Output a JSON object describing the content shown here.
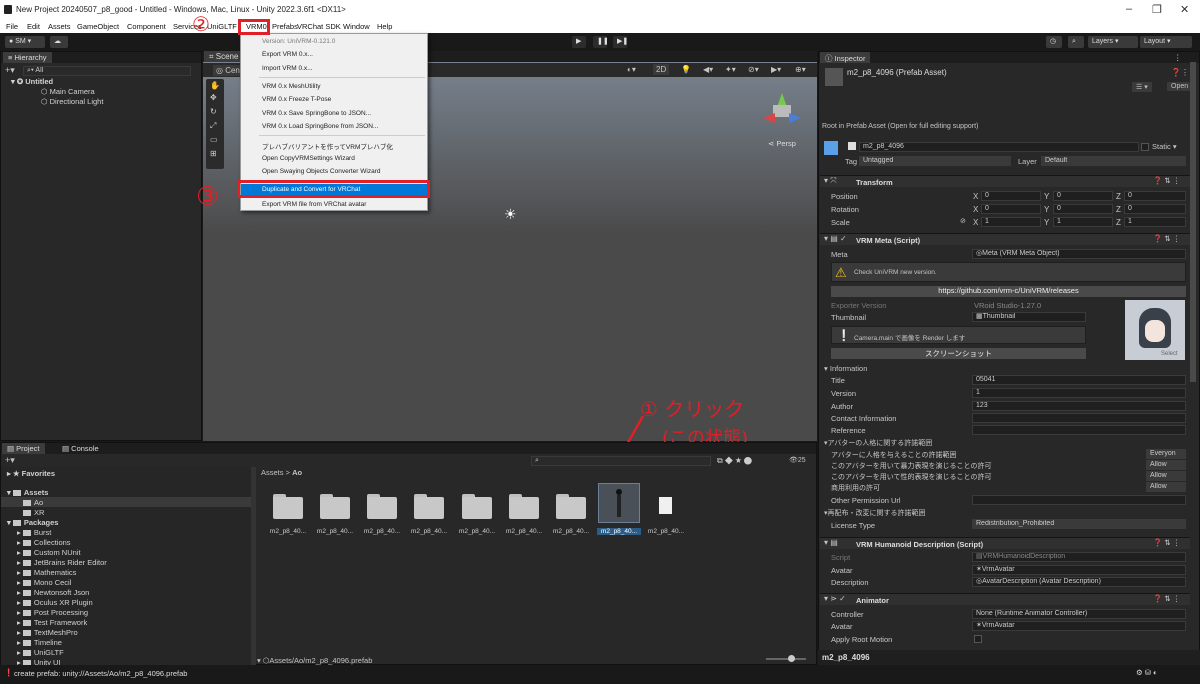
{
  "window": {
    "title": "New Project 20240507_p8_good - Untitled - Windows, Mac, Linux - Unity 2022.3.6f1 <DX11>"
  },
  "menubar": [
    "File",
    "Edit",
    "Assets",
    "GameObject",
    "Component",
    "Services",
    "UniGLTF",
    "VRM0",
    "Prefabs",
    "VRChat SDK",
    "Window",
    "Help"
  ],
  "toolbar": {
    "account": "SM",
    "layers": "Layers",
    "layout": "Layout"
  },
  "hierarchy": {
    "tab": "Hierarchy",
    "search": "All",
    "scene": "Untitled",
    "items": [
      "Main Camera",
      "Directional Light"
    ]
  },
  "scene_view": {
    "tab": "Scene",
    "persp": "Persp",
    "mode_2d": "2D",
    "camera_label": "Cen"
  },
  "vrm_menu": {
    "items": [
      "Version: UniVRM-0.121.0",
      "Export VRM 0.x...",
      "Import VRM 0.x...",
      "VRM 0.x MeshUtility",
      "VRM 0.x Freeze T-Pose",
      "VRM 0.x Save SpringBone to JSON...",
      "VRM 0.x Load SpringBone from JSON...",
      "プレハブバリアントを作ってVRMプレハブ化",
      "Open CopyVRMSettings Wizard",
      "Open Swaying Objects Converter Wizard",
      "Duplicate and Convert for VRChat",
      "Export VRM file from VRChat avatar"
    ]
  },
  "annotations": {
    "step1": "① クリック",
    "step1b": "(この状態)",
    "step2": "②",
    "step3": "③"
  },
  "project": {
    "tabs": [
      "Project",
      "Console"
    ],
    "favorites": "Favorites",
    "assets": "Assets",
    "asset_children": [
      "Ao",
      "XR"
    ],
    "packages": "Packages",
    "package_children": [
      "Burst",
      "Collections",
      "Custom NUnit",
      "JetBrains Rider Editor",
      "Mathematics",
      "Mono Cecil",
      "Newtonsoft Json",
      "Oculus XR Plugin",
      "Post Processing",
      "Test Framework",
      "TextMeshPro",
      "Timeline",
      "UniGLTF",
      "Unity UI"
    ],
    "breadcrumb": [
      "Assets",
      "Ao"
    ],
    "files": [
      "m2_p8_40...",
      "m2_p8_40...",
      "m2_p8_40...",
      "m2_p8_40...",
      "m2_p8_40...",
      "m2_p8_40...",
      "m2_p8_40...",
      "m2_p8_40...",
      "m2_p8_40..."
    ],
    "path": "Assets/Ao/m2_p8_4096.prefab",
    "count": "25"
  },
  "inspector": {
    "tab": "Inspector",
    "name": "m2_p8_4096 (Prefab Asset)",
    "open": "Open",
    "root_note": "Root in Prefab Asset (Open for full editing support)",
    "obj_name": "m2_p8_4096",
    "static": "Static",
    "tag_label": "Tag",
    "tag": "Untagged",
    "layer_label": "Layer",
    "layer": "Default",
    "transform": {
      "title": "Transform",
      "rows": [
        {
          "label": "Position",
          "x": "0",
          "y": "0",
          "z": "0"
        },
        {
          "label": "Rotation",
          "x": "0",
          "y": "0",
          "z": "0"
        },
        {
          "label": "Scale",
          "x": "1",
          "y": "1",
          "z": "1"
        }
      ]
    },
    "vrm_meta": {
      "title": "VRM Meta (Script)",
      "meta_label": "Meta",
      "meta_value": "Meta (VRM Meta Object)",
      "warning": "Check UniVRM new version.",
      "url": "https://github.com/vrm-c/UniVRM/releases",
      "exporter_label": "Exporter Version",
      "exporter": "VRoid Studio-1.27.0",
      "thumbnail_label": "Thumbnail",
      "thumbnail": "Thumbnail",
      "camera_note": "Camera.main で画像を Render します",
      "screenshot": "スクリーンショット",
      "select": "Select",
      "info_header": "Information",
      "info": [
        {
          "label": "Title",
          "value": "05041"
        },
        {
          "label": "Version",
          "value": "1"
        },
        {
          "label": "Author",
          "value": "123"
        },
        {
          "label": "Contact Information",
          "value": ""
        },
        {
          "label": "Reference",
          "value": ""
        }
      ],
      "perm_header": "アバターの人格に関する許諾範囲",
      "perms": [
        {
          "label": "アバターに人格を与えることの許諾範囲",
          "value": "Everyon"
        },
        {
          "label": "このアバターを用いて暴力表現を演じることの許可",
          "value": "Allow"
        },
        {
          "label": "このアバターを用いて性的表現を演じることの許可",
          "value": "Allow"
        },
        {
          "label": "商用利用の許可",
          "value": "Allow"
        }
      ],
      "other_perm": "Other Permission Url",
      "redist_header": "再配布・改変に関する許諾範囲",
      "license_label": "License Type",
      "license": "Redistribution_Prohibited"
    },
    "humanoid": {
      "title": "VRM Humanoid Description (Script)",
      "rows": [
        {
          "label": "Script",
          "value": "VRMHumanoidDescription"
        },
        {
          "label": "Avatar",
          "value": "VrmAvatar"
        },
        {
          "label": "Description",
          "value": "AvatarDescription (Avatar Description)"
        }
      ]
    },
    "animator": {
      "title": "Animator",
      "rows": [
        {
          "label": "Controller",
          "value": "None (Runtime Animator Controller)"
        },
        {
          "label": "Avatar",
          "value": "VrmAvatar"
        },
        {
          "label": "Apply Root Motion",
          "value": ""
        }
      ]
    },
    "footer": "m2_p8_4096"
  },
  "status": {
    "text": "create prefab: unity://Assets/Ao/m2_p8_4096.prefab"
  }
}
